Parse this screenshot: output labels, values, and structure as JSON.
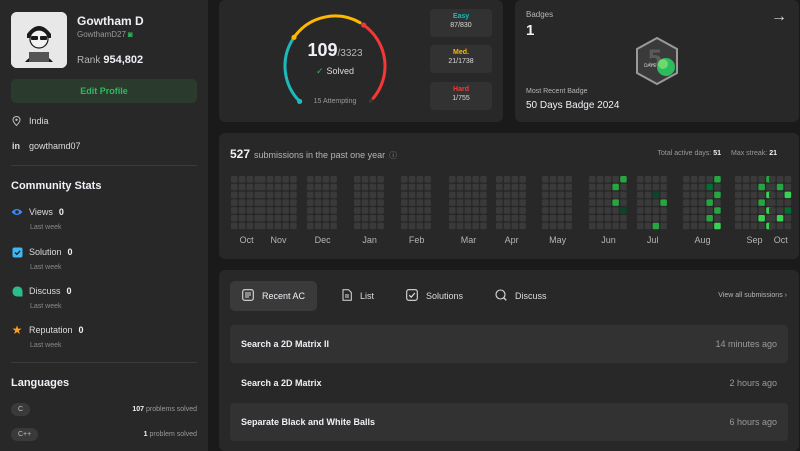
{
  "profile": {
    "name": "Gowtham D",
    "username": "GowthamD27",
    "rank_label": "Rank",
    "rank_value": "954,802",
    "edit_label": "Edit Profile",
    "location": "India",
    "linkedin": "gowthamd07"
  },
  "community": {
    "title": "Community Stats",
    "items": [
      {
        "label": "Views",
        "value": "0",
        "sub": "Last week",
        "icon": "eye-icon",
        "color": "#3d8af7"
      },
      {
        "label": "Solution",
        "value": "0",
        "sub": "Last week",
        "icon": "solution-icon",
        "color": "#3db8f5"
      },
      {
        "label": "Discuss",
        "value": "0",
        "sub": "Last week",
        "icon": "discuss-icon",
        "color": "#2cbb8d"
      },
      {
        "label": "Reputation",
        "value": "0",
        "sub": "Last week",
        "icon": "star-icon",
        "color": "#ffa116"
      }
    ]
  },
  "languages": {
    "title": "Languages",
    "items": [
      {
        "name": "C",
        "count": "107",
        "suffix": "problems solved"
      },
      {
        "name": "C++",
        "count": "1",
        "suffix": "problem solved"
      }
    ]
  },
  "progress": {
    "solved": "109",
    "total": "/3323",
    "solved_label": "Solved",
    "attempting": "15 Attempting",
    "easy": {
      "label": "Easy",
      "value": "87/830",
      "color": "#1cbaba"
    },
    "medium": {
      "label": "Med.",
      "value": "21/1738",
      "color": "#ffb700"
    },
    "hard": {
      "label": "Hard",
      "value": "1/755",
      "color": "#f63737"
    }
  },
  "badges": {
    "title": "Badges",
    "count": "1",
    "recent_label": "Most Recent Badge",
    "recent_name": "50 Days Badge 2024",
    "badge_text": "DAYS"
  },
  "heatmap": {
    "count": "527",
    "caption": "submissions in the past one year",
    "active_label": "Total active days:",
    "active_value": "51",
    "streak_label": "Max streak:",
    "streak_value": "21",
    "months": [
      "Oct",
      "Nov",
      "Dec",
      "Jan",
      "Feb",
      "Mar",
      "Apr",
      "May",
      "Jun",
      "Jul",
      "Aug",
      "Sep",
      "Oct"
    ]
  },
  "recent": {
    "tabs": [
      {
        "label": "Recent AC",
        "icon": "recent-ac-icon"
      },
      {
        "label": "List",
        "icon": "list-icon"
      },
      {
        "label": "Solutions",
        "icon": "solutions-icon"
      },
      {
        "label": "Discuss",
        "icon": "discuss-search-icon"
      }
    ],
    "view_all": "View all submissions",
    "rows": [
      {
        "title": "Search a 2D Matrix II",
        "time": "14 minutes ago"
      },
      {
        "title": "Search a 2D Matrix",
        "time": "2 hours ago"
      },
      {
        "title": "Separate Black and White Balls",
        "time": "6 hours ago"
      }
    ]
  }
}
